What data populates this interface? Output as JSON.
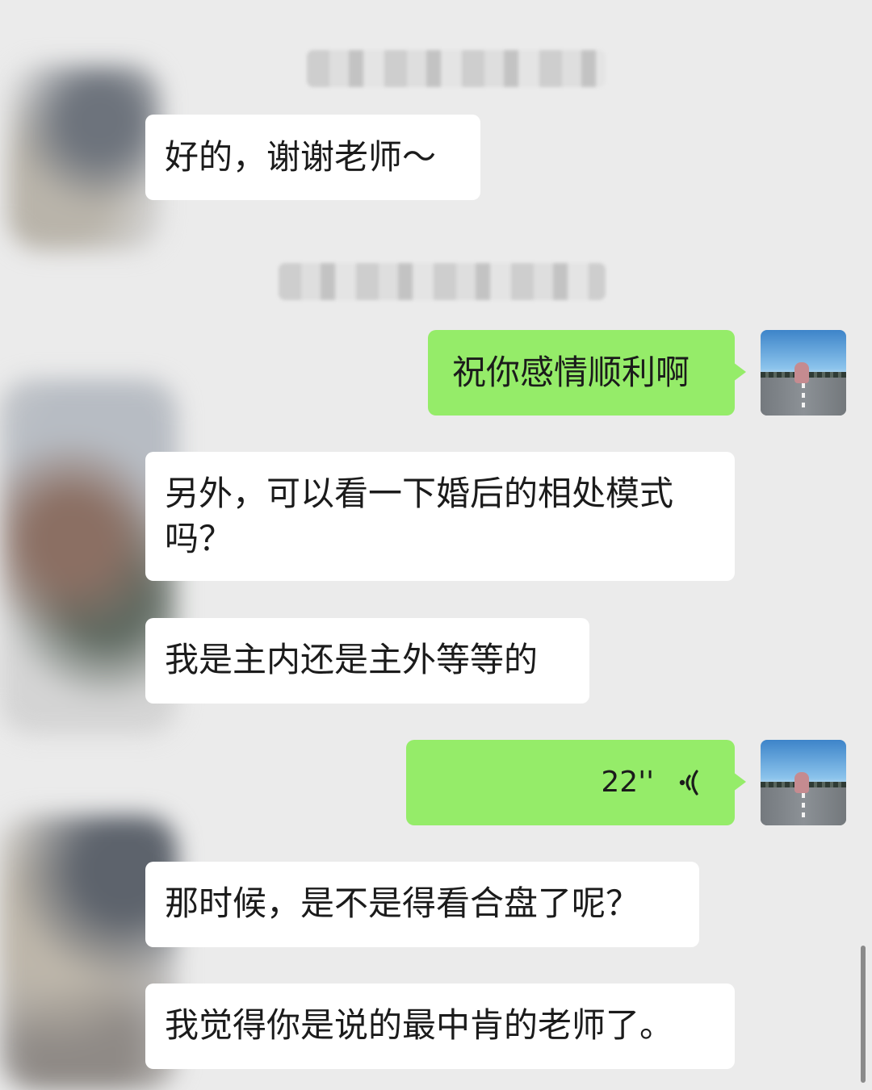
{
  "chat": {
    "messages": [
      {
        "from": "other",
        "type": "text",
        "text": "好的，谢谢老师～"
      },
      {
        "from": "me",
        "type": "text",
        "text": "祝你感情顺利啊"
      },
      {
        "from": "other",
        "type": "text",
        "text": "另外，可以看一下婚后的相处模式吗？"
      },
      {
        "from": "other",
        "type": "text",
        "text": "我是主内还是主外等等的"
      },
      {
        "from": "me",
        "type": "voice",
        "duration": "22''"
      },
      {
        "from": "other",
        "type": "text",
        "text": "那时候，是不是得看合盘了呢？"
      },
      {
        "from": "other",
        "type": "text",
        "text": "我觉得你是说的最中肯的老师了。"
      }
    ]
  },
  "colors": {
    "background": "#ebebeb",
    "incoming_bubble": "#ffffff",
    "outgoing_bubble": "#95ec69"
  },
  "icons": {
    "voice": "voice-wave-icon"
  }
}
